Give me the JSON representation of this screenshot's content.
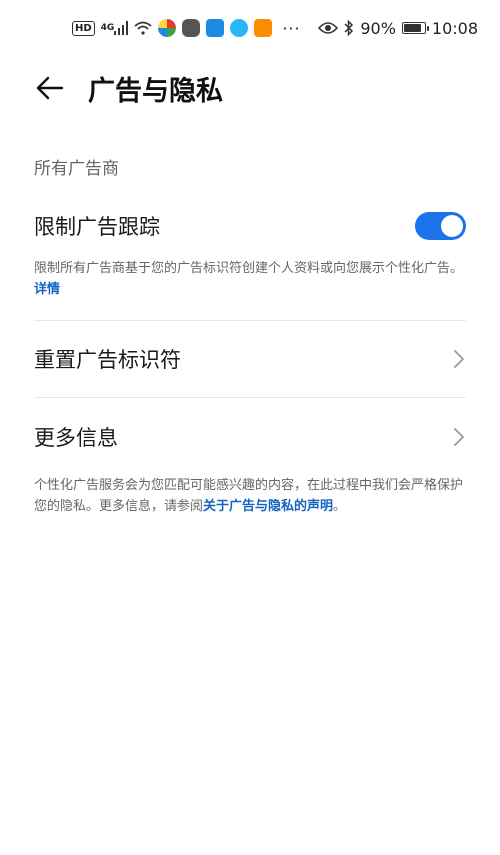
{
  "status_bar": {
    "hd": "HD",
    "network": "4G",
    "battery": "90%",
    "battery_level": 0.9,
    "time": "10:08",
    "more": "···",
    "icons": [
      "hd-icon",
      "signal-icon",
      "wifi-icon",
      "app-icon",
      "app-icon",
      "app-icon",
      "app-icon",
      "app-icon",
      "more-icon",
      "eye-icon",
      "bluetooth-icon",
      "battery-icon"
    ]
  },
  "header": {
    "title": "广告与隐私",
    "back_icon": "back-arrow-icon"
  },
  "section": {
    "label": "所有广告商"
  },
  "limit_tracking": {
    "label": "限制广告跟踪",
    "enabled": true,
    "description": "限制所有广告商基于您的广告标识符创建个人资料或向您展示个性化广告。",
    "link": "详情",
    "toggle_color": "#1a73e8"
  },
  "reset_id": {
    "label": "重置广告标识符",
    "icon": "chevron-right-icon"
  },
  "more_info": {
    "label": "更多信息",
    "icon": "chevron-right-icon"
  },
  "footer": {
    "text": "个性化广告服务会为您匹配可能感兴趣的内容，在此过程中我们会严格保护您的隐私。更多信息，请参阅",
    "link": "关于广告与隐私的声明",
    "end": "。"
  },
  "colors": {
    "accent": "#1a73e8",
    "link": "#1565c0"
  }
}
